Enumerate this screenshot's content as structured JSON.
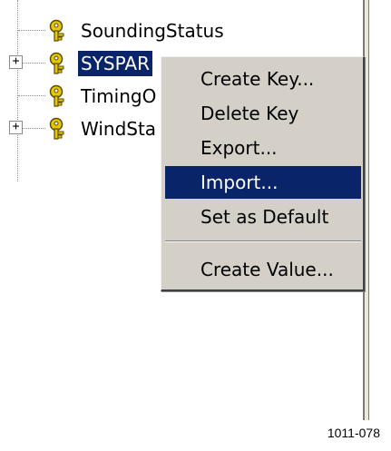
{
  "tree": {
    "partial_top_label": "",
    "nodes": [
      {
        "label": "SoundingStatus",
        "expandable": false,
        "selected": false
      },
      {
        "label": "SYSPAR",
        "expandable": true,
        "selected": true
      },
      {
        "label": "TimingO",
        "expandable": false,
        "selected": false
      },
      {
        "label": "WindSta",
        "expandable": true,
        "selected": false
      }
    ],
    "expander_glyph": "+"
  },
  "context_menu": {
    "items": [
      {
        "label": "Create Key...",
        "highlighted": false
      },
      {
        "label": "Delete Key",
        "highlighted": false
      },
      {
        "label": "Export...",
        "highlighted": false
      },
      {
        "label": "Import...",
        "highlighted": true
      },
      {
        "label": "Set as Default",
        "highlighted": false
      },
      {
        "label": "Create Value...",
        "highlighted": false
      }
    ]
  },
  "figure_code": "1011-078",
  "colors": {
    "highlight": "#0a246a",
    "menu_face": "#d4d0c8",
    "key_icon": "#e8c800"
  }
}
